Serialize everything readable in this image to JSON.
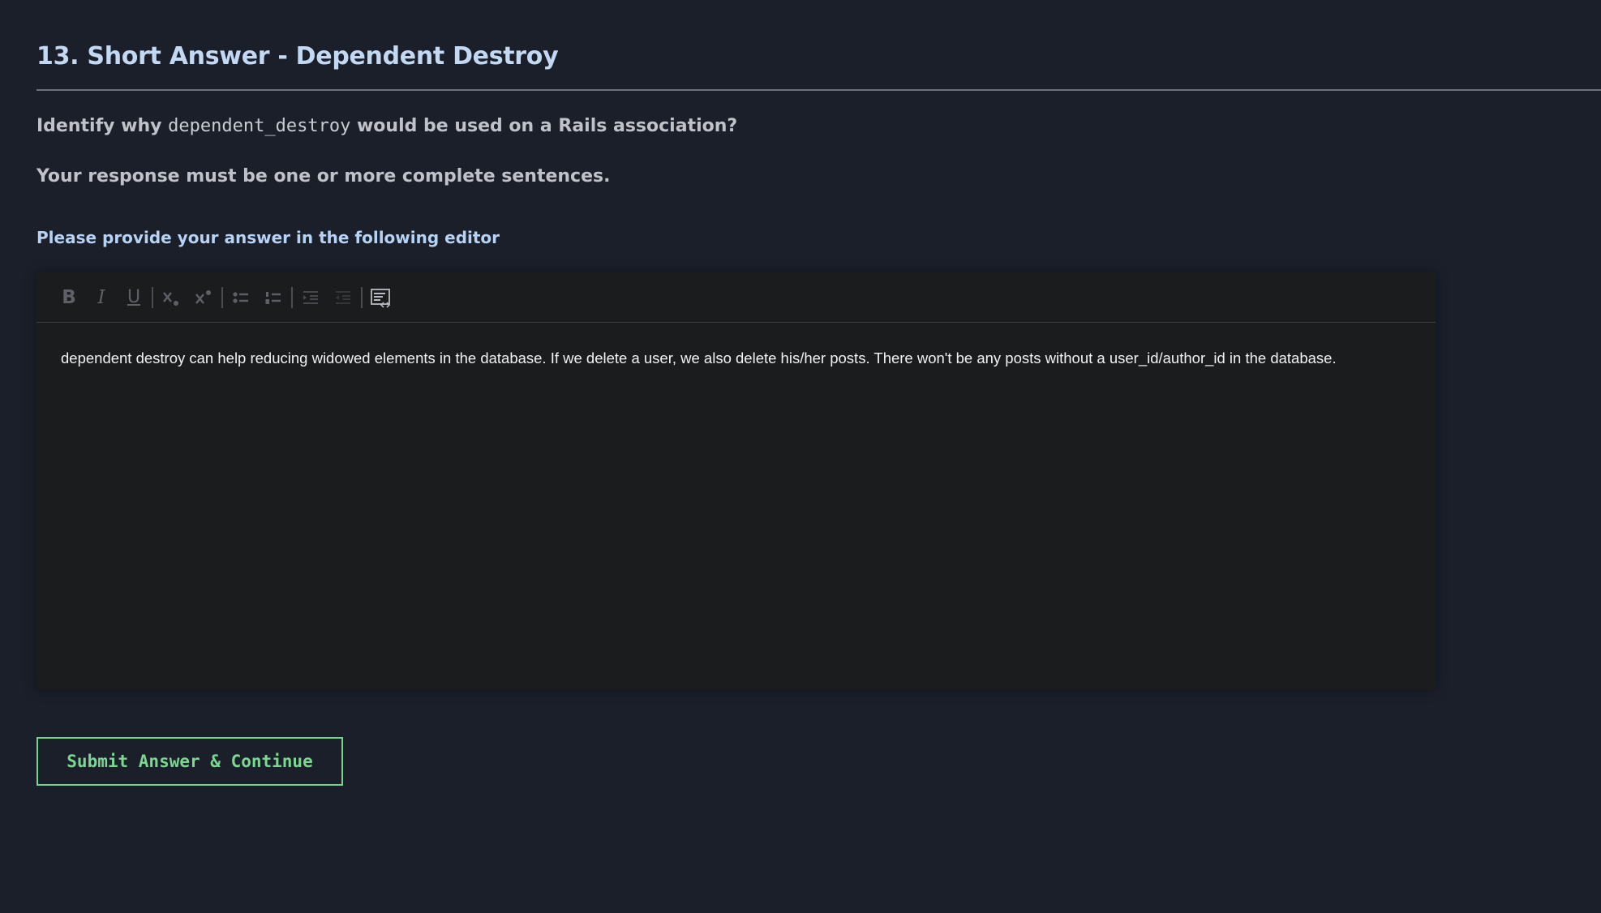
{
  "header": {
    "title": "13. Short Answer - Dependent Destroy"
  },
  "question": {
    "prefix": "Identify why ",
    "code": "dependent_destroy",
    "suffix": " would be used on a Rails association?",
    "requirement": "Your response must be one or more complete sentences."
  },
  "editor": {
    "prompt": "Please provide your answer in the following editor",
    "toolbar": {
      "bold_glyph": "B",
      "italic_glyph": "I",
      "underline_glyph": "U",
      "icons": [
        "bold-icon",
        "italic-icon",
        "underline-icon",
        "subscript-icon",
        "superscript-icon",
        "bulleted-list-icon",
        "numbered-list-icon",
        "indent-icon",
        "outdent-icon",
        "source-code-icon"
      ]
    },
    "content": "dependent destroy can help reducing widowed elements in the database. If we delete a user, we also delete his/her posts. There won't be any posts without a user_id/author_id in the database."
  },
  "actions": {
    "submit_label": "Submit Answer & Continue"
  },
  "colors": {
    "background": "#1b1f2a",
    "title": "#c3d8f2",
    "submit_accent": "#79d28f",
    "editor_bg": "#1b1c1e"
  }
}
